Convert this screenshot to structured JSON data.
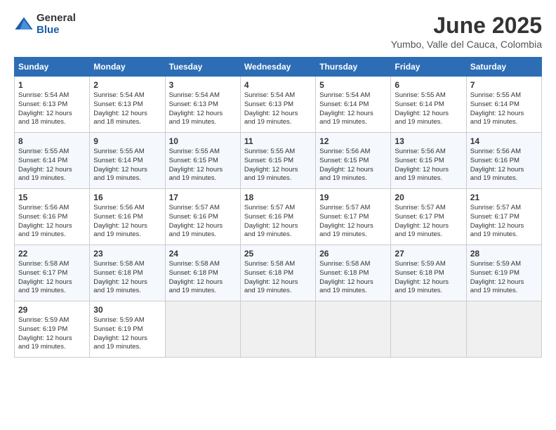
{
  "logo": {
    "general": "General",
    "blue": "Blue"
  },
  "title": "June 2025",
  "subtitle": "Yumbo, Valle del Cauca, Colombia",
  "days_header": [
    "Sunday",
    "Monday",
    "Tuesday",
    "Wednesday",
    "Thursday",
    "Friday",
    "Saturday"
  ],
  "weeks": [
    [
      {
        "day": "1",
        "sunrise": "5:54 AM",
        "sunset": "6:13 PM",
        "daylight": "12 hours and 18 minutes."
      },
      {
        "day": "2",
        "sunrise": "5:54 AM",
        "sunset": "6:13 PM",
        "daylight": "12 hours and 18 minutes."
      },
      {
        "day": "3",
        "sunrise": "5:54 AM",
        "sunset": "6:13 PM",
        "daylight": "12 hours and 19 minutes."
      },
      {
        "day": "4",
        "sunrise": "5:54 AM",
        "sunset": "6:13 PM",
        "daylight": "12 hours and 19 minutes."
      },
      {
        "day": "5",
        "sunrise": "5:54 AM",
        "sunset": "6:14 PM",
        "daylight": "12 hours and 19 minutes."
      },
      {
        "day": "6",
        "sunrise": "5:55 AM",
        "sunset": "6:14 PM",
        "daylight": "12 hours and 19 minutes."
      },
      {
        "day": "7",
        "sunrise": "5:55 AM",
        "sunset": "6:14 PM",
        "daylight": "12 hours and 19 minutes."
      }
    ],
    [
      {
        "day": "8",
        "sunrise": "5:55 AM",
        "sunset": "6:14 PM",
        "daylight": "12 hours and 19 minutes."
      },
      {
        "day": "9",
        "sunrise": "5:55 AM",
        "sunset": "6:14 PM",
        "daylight": "12 hours and 19 minutes."
      },
      {
        "day": "10",
        "sunrise": "5:55 AM",
        "sunset": "6:15 PM",
        "daylight": "12 hours and 19 minutes."
      },
      {
        "day": "11",
        "sunrise": "5:55 AM",
        "sunset": "6:15 PM",
        "daylight": "12 hours and 19 minutes."
      },
      {
        "day": "12",
        "sunrise": "5:56 AM",
        "sunset": "6:15 PM",
        "daylight": "12 hours and 19 minutes."
      },
      {
        "day": "13",
        "sunrise": "5:56 AM",
        "sunset": "6:15 PM",
        "daylight": "12 hours and 19 minutes."
      },
      {
        "day": "14",
        "sunrise": "5:56 AM",
        "sunset": "6:16 PM",
        "daylight": "12 hours and 19 minutes."
      }
    ],
    [
      {
        "day": "15",
        "sunrise": "5:56 AM",
        "sunset": "6:16 PM",
        "daylight": "12 hours and 19 minutes."
      },
      {
        "day": "16",
        "sunrise": "5:56 AM",
        "sunset": "6:16 PM",
        "daylight": "12 hours and 19 minutes."
      },
      {
        "day": "17",
        "sunrise": "5:57 AM",
        "sunset": "6:16 PM",
        "daylight": "12 hours and 19 minutes."
      },
      {
        "day": "18",
        "sunrise": "5:57 AM",
        "sunset": "6:16 PM",
        "daylight": "12 hours and 19 minutes."
      },
      {
        "day": "19",
        "sunrise": "5:57 AM",
        "sunset": "6:17 PM",
        "daylight": "12 hours and 19 minutes."
      },
      {
        "day": "20",
        "sunrise": "5:57 AM",
        "sunset": "6:17 PM",
        "daylight": "12 hours and 19 minutes."
      },
      {
        "day": "21",
        "sunrise": "5:57 AM",
        "sunset": "6:17 PM",
        "daylight": "12 hours and 19 minutes."
      }
    ],
    [
      {
        "day": "22",
        "sunrise": "5:58 AM",
        "sunset": "6:17 PM",
        "daylight": "12 hours and 19 minutes."
      },
      {
        "day": "23",
        "sunrise": "5:58 AM",
        "sunset": "6:18 PM",
        "daylight": "12 hours and 19 minutes."
      },
      {
        "day": "24",
        "sunrise": "5:58 AM",
        "sunset": "6:18 PM",
        "daylight": "12 hours and 19 minutes."
      },
      {
        "day": "25",
        "sunrise": "5:58 AM",
        "sunset": "6:18 PM",
        "daylight": "12 hours and 19 minutes."
      },
      {
        "day": "26",
        "sunrise": "5:58 AM",
        "sunset": "6:18 PM",
        "daylight": "12 hours and 19 minutes."
      },
      {
        "day": "27",
        "sunrise": "5:59 AM",
        "sunset": "6:18 PM",
        "daylight": "12 hours and 19 minutes."
      },
      {
        "day": "28",
        "sunrise": "5:59 AM",
        "sunset": "6:19 PM",
        "daylight": "12 hours and 19 minutes."
      }
    ],
    [
      {
        "day": "29",
        "sunrise": "5:59 AM",
        "sunset": "6:19 PM",
        "daylight": "12 hours and 19 minutes."
      },
      {
        "day": "30",
        "sunrise": "5:59 AM",
        "sunset": "6:19 PM",
        "daylight": "12 hours and 19 minutes."
      },
      null,
      null,
      null,
      null,
      null
    ]
  ]
}
